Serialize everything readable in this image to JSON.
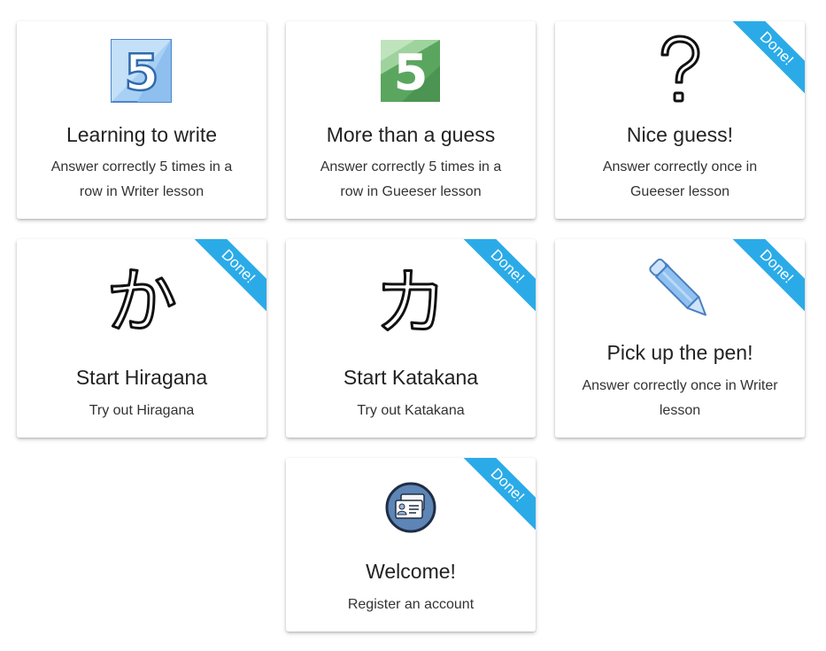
{
  "achievements": [
    {
      "title": "Learning to write",
      "description": "Answer correctly 5 times in a row in Writer lesson",
      "badge": "",
      "icon": "five-blue-icon"
    },
    {
      "title": "More than a guess",
      "description": "Answer correctly 5 times in a row in Gueeser lesson",
      "badge": "",
      "icon": "five-green-icon"
    },
    {
      "title": "Nice guess!",
      "description": "Answer correctly once in Gueeser lesson",
      "badge": "Done!",
      "icon": "question-mark-icon"
    },
    {
      "title": "Start Hiragana",
      "description": "Try out Hiragana",
      "badge": "Done!",
      "icon": "hiragana-ka-icon",
      "glyph": "か"
    },
    {
      "title": "Start Katakana",
      "description": "Try out Katakana",
      "badge": "Done!",
      "icon": "katakana-ka-icon",
      "glyph": "カ"
    },
    {
      "title": "Pick up the pen!",
      "description": "Answer correctly once in Writer lesson",
      "badge": "Done!",
      "icon": "pen-icon"
    },
    {
      "title": "Welcome!",
      "description": "Register an account",
      "badge": "Done!",
      "icon": "id-card-icon"
    }
  ],
  "colors": {
    "ribbon": "#2aabe8",
    "blue_five": "#9ccaf2",
    "green_five": "#5aa65f",
    "pen": "#8fc0f0",
    "id_badge": "#5d85b5"
  }
}
